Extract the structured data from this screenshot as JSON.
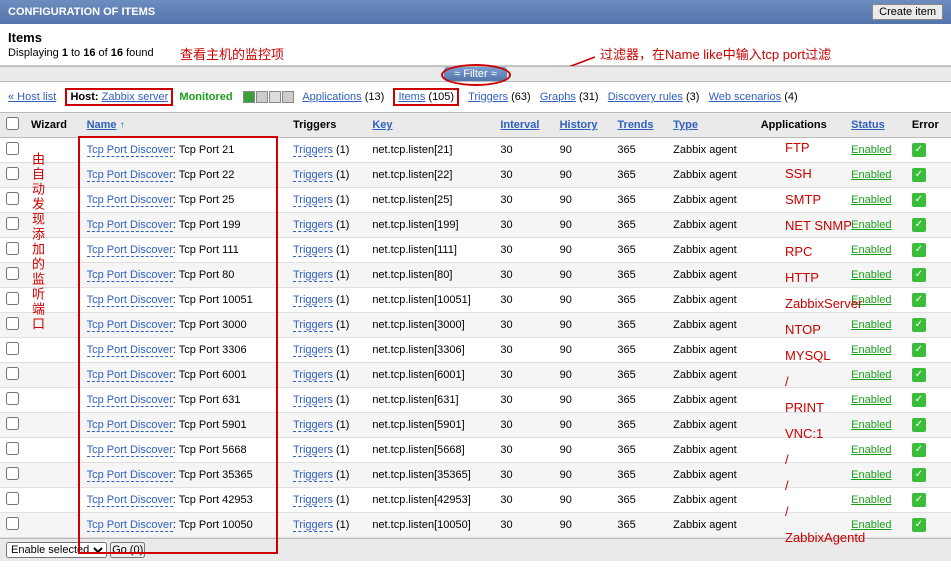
{
  "header": {
    "title": "CONFIGURATION OF ITEMS",
    "create_btn": "Create item"
  },
  "items_header": {
    "title": "Items",
    "count_prefix": "Displaying ",
    "count_from": "1",
    "count_mid": " to ",
    "count_to": "16",
    "count_of": " of ",
    "count_total": "16",
    "count_suffix": " found"
  },
  "annotations": {
    "view_host": "查看主机的监控项",
    "filter_hint": "过滤器，在Name like中输入tcp port过滤",
    "vertical": "由自动发现添加的监听端口"
  },
  "filter": {
    "label": "Filter"
  },
  "nav": {
    "host_list": "« Host list",
    "host_label": "Host:",
    "host_name": "Zabbix server",
    "monitored": "Monitored",
    "applications": "Applications",
    "applications_n": "(13)",
    "items": "Items",
    "items_n": "(105)",
    "triggers": "Triggers",
    "triggers_n": "(63)",
    "graphs": "Graphs",
    "graphs_n": "(31)",
    "discovery": "Discovery rules",
    "discovery_n": "(3)",
    "web": "Web scenarios",
    "web_n": "(4)"
  },
  "cols": {
    "wizard": "Wizard",
    "name": "Name",
    "triggers": "Triggers",
    "key": "Key",
    "interval": "Interval",
    "history": "History",
    "trends": "Trends",
    "type": "Type",
    "applications": "Applications",
    "status": "Status",
    "error": "Error"
  },
  "row_labels": {
    "discover": "Tcp Port Discover",
    "tcp_prefix": ": Tcp Port ",
    "triggers_link": "Triggers",
    "triggers_n": "(1)",
    "type_val": "Zabbix agent",
    "status_val": "Enabled"
  },
  "rows": [
    {
      "port": "21",
      "key": "net.tcp.listen[21]",
      "interval": "30",
      "history": "90",
      "trends": "365",
      "app": "FTP"
    },
    {
      "port": "22",
      "key": "net.tcp.listen[22]",
      "interval": "30",
      "history": "90",
      "trends": "365",
      "app": "SSH"
    },
    {
      "port": "25",
      "key": "net.tcp.listen[25]",
      "interval": "30",
      "history": "90",
      "trends": "365",
      "app": "SMTP"
    },
    {
      "port": "199",
      "key": "net.tcp.listen[199]",
      "interval": "30",
      "history": "90",
      "trends": "365",
      "app": "NET SNMP"
    },
    {
      "port": "111",
      "key": "net.tcp.listen[111]",
      "interval": "30",
      "history": "90",
      "trends": "365",
      "app": "RPC"
    },
    {
      "port": "80",
      "key": "net.tcp.listen[80]",
      "interval": "30",
      "history": "90",
      "trends": "365",
      "app": "HTTP"
    },
    {
      "port": "10051",
      "key": "net.tcp.listen[10051]",
      "interval": "30",
      "history": "90",
      "trends": "365",
      "app": "ZabbixServer"
    },
    {
      "port": "3000",
      "key": "net.tcp.listen[3000]",
      "interval": "30",
      "history": "90",
      "trends": "365",
      "app": "NTOP"
    },
    {
      "port": "3306",
      "key": "net.tcp.listen[3306]",
      "interval": "30",
      "history": "90",
      "trends": "365",
      "app": "MYSQL"
    },
    {
      "port": "6001",
      "key": "net.tcp.listen[6001]",
      "interval": "30",
      "history": "90",
      "trends": "365",
      "app": "/"
    },
    {
      "port": "631",
      "key": "net.tcp.listen[631]",
      "interval": "30",
      "history": "90",
      "trends": "365",
      "app": "PRINT"
    },
    {
      "port": "5901",
      "key": "net.tcp.listen[5901]",
      "interval": "30",
      "history": "90",
      "trends": "365",
      "app": "VNC:1"
    },
    {
      "port": "5668",
      "key": "net.tcp.listen[5668]",
      "interval": "30",
      "history": "90",
      "trends": "365",
      "app": "/"
    },
    {
      "port": "35365",
      "key": "net.tcp.listen[35365]",
      "interval": "30",
      "history": "90",
      "trends": "365",
      "app": "/"
    },
    {
      "port": "42953",
      "key": "net.tcp.listen[42953]",
      "interval": "30",
      "history": "90",
      "trends": "365",
      "app": "/"
    },
    {
      "port": "10050",
      "key": "net.tcp.listen[10050]",
      "interval": "30",
      "history": "90",
      "trends": "365",
      "app": "ZabbixAgentd"
    }
  ],
  "footer": {
    "select": "Enable selected",
    "go": "Go (0)"
  }
}
